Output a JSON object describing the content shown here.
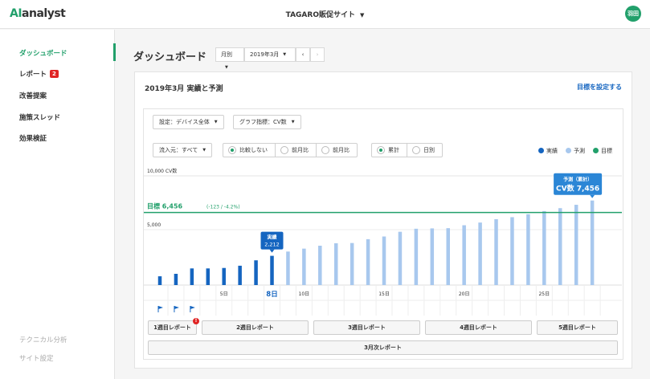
{
  "header": {
    "logo_ai": "AI",
    "logo_text": "analyst",
    "site_name": "TAGARO販促サイト",
    "avatar": "羽田"
  },
  "sidebar": {
    "items": [
      {
        "label": "ダッシュボード"
      },
      {
        "label": "レポート",
        "badge": "2"
      },
      {
        "label": "改善提案"
      },
      {
        "label": "施策スレッド"
      },
      {
        "label": "効果検証"
      }
    ],
    "bottom": [
      {
        "label": "テクニカル分析"
      },
      {
        "label": "サイト設定"
      }
    ]
  },
  "page": {
    "title": "ダッシュボード",
    "period_type": "月別",
    "period": "2019年3月",
    "prev": "‹",
    "next": "›"
  },
  "card": {
    "title": "2019年3月 実績と予測",
    "goal_link": "目標を設定する",
    "filters": {
      "segment": "設定：デバイス全体",
      "metric": "グラフ指標：CV数",
      "source": "流入元：すべて"
    },
    "compare": [
      "比較しない",
      "前月比",
      "前月比"
    ],
    "mode": [
      "累計",
      "日別"
    ],
    "legend": [
      {
        "label": "実績",
        "color": "#1565c0"
      },
      {
        "label": "予測",
        "color": "#a8c8ee"
      },
      {
        "label": "目標",
        "color": "#22a06b"
      }
    ],
    "reports": [
      "1週目レポート",
      "2週目レポート",
      "3週目レポート",
      "4週目レポート",
      "5週目レポート"
    ],
    "month_report": "3月次レポート",
    "alert": "!"
  },
  "chart_data": {
    "type": "bar",
    "y_top_label": "10,000 CV数",
    "y_mid_label": "5,000",
    "ylim": [
      0,
      10000
    ],
    "x_ticks": [
      {
        "day": 5,
        "label": "5日"
      },
      {
        "day": 10,
        "label": "10日"
      },
      {
        "day": 15,
        "label": "15日"
      },
      {
        "day": 20,
        "label": "20日"
      },
      {
        "day": 25,
        "label": "25日"
      }
    ],
    "current_day": 8,
    "current_day_label": "8日",
    "days": [
      1,
      2,
      3,
      4,
      5,
      6,
      7,
      8,
      9,
      10,
      11,
      12,
      13,
      14,
      15,
      16,
      17,
      18,
      19,
      20,
      21,
      22,
      23,
      24,
      25,
      26,
      27,
      28
    ],
    "actual": [
      780,
      1000,
      1480,
      1480,
      1520,
      1720,
      2200,
      2600
    ],
    "forecast": [
      2980,
      3240,
      3500,
      3720,
      3740,
      4080,
      4320,
      4740,
      5010,
      5040,
      5060,
      5320,
      5560,
      5860,
      6040,
      6300,
      6580,
      6840,
      7140,
      7520
    ],
    "goal": 6456,
    "goal_label": "目標 6,456",
    "goal_diff": "(-123 / -4.2%)",
    "actual_callout": {
      "title": "実績",
      "value": "2,212"
    },
    "forecast_callout": {
      "title": "予測（累計）",
      "value": "CV数 7,456"
    },
    "flag_days": [
      1,
      2,
      3
    ]
  }
}
